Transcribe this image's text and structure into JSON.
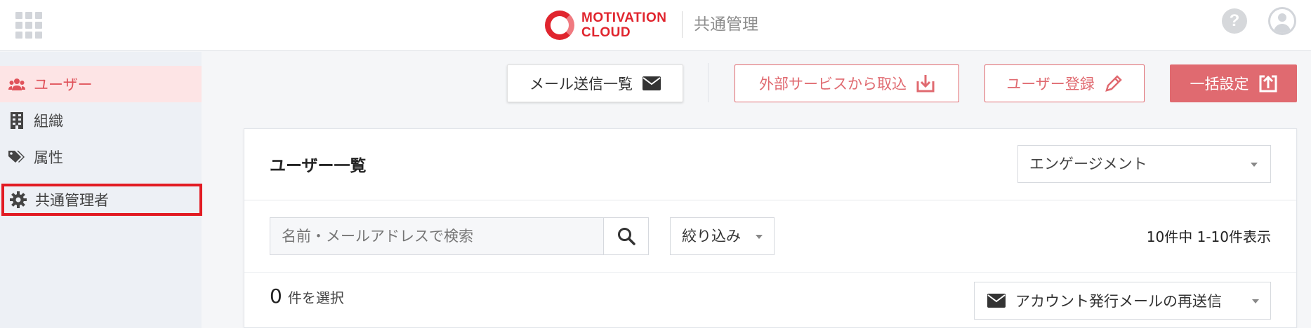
{
  "header": {
    "logo_line1": "MOTIVATION",
    "logo_line2": "CLOUD",
    "app_name": "共通管理",
    "help_glyph": "?"
  },
  "sidebar": {
    "items": [
      {
        "label": "ユーザー",
        "icon": "users-icon",
        "active": true
      },
      {
        "label": "組織",
        "icon": "building-icon"
      },
      {
        "label": "属性",
        "icon": "tags-icon"
      },
      {
        "label": "共通管理者",
        "icon": "gear-icon",
        "highlighted": true
      }
    ]
  },
  "toolbar": {
    "mail_list": "メール送信一覧",
    "import": "外部サービスから取込",
    "register": "ユーザー登録",
    "bulk": "一括設定"
  },
  "card": {
    "title": "ユーザー一覧",
    "product_select": "エンゲージメント",
    "search_placeholder": "名前・メールアドレスで検索",
    "filter": "絞り込み",
    "count": "10件中 1-10件表示",
    "selected_count": "0",
    "selected_label": "件を選択",
    "resend": "アカウント発行メールの再送信"
  },
  "colors": {
    "brand": "#e0252e",
    "accent": "#e06a70",
    "highlight_box": "#e21b23"
  }
}
